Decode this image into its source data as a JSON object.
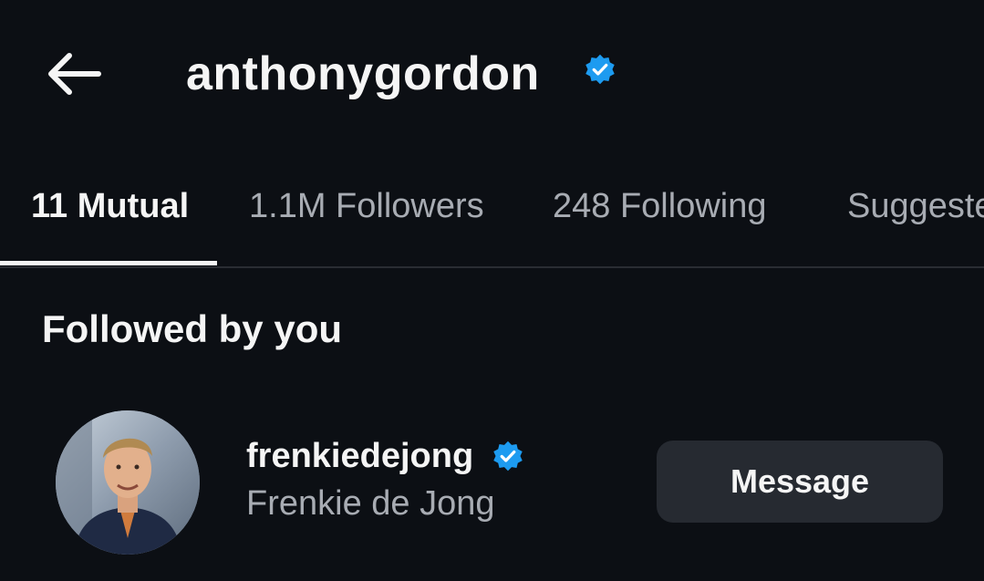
{
  "header": {
    "back_icon": "arrow-left-icon",
    "username": "anthonygordon",
    "verified_icon": "verified-badge-icon",
    "verified_color": "#1d9bf0"
  },
  "tabs": [
    {
      "label": "11 Mutual",
      "active": true
    },
    {
      "label": "1.1M Followers",
      "active": false
    },
    {
      "label": "248 Following",
      "active": false
    },
    {
      "label": "Suggested",
      "active": false
    }
  ],
  "section": {
    "title": "Followed by you"
  },
  "users": [
    {
      "username": "frenkiedejong",
      "full_name": "Frenkie de Jong",
      "verified": true,
      "avatar_icon": "profile-photo",
      "action_label": "Message"
    }
  ],
  "colors": {
    "background": "#0c0f14",
    "text_primary": "#f5f5f5",
    "text_secondary": "#a8acb3",
    "button_bg": "#262a31"
  }
}
